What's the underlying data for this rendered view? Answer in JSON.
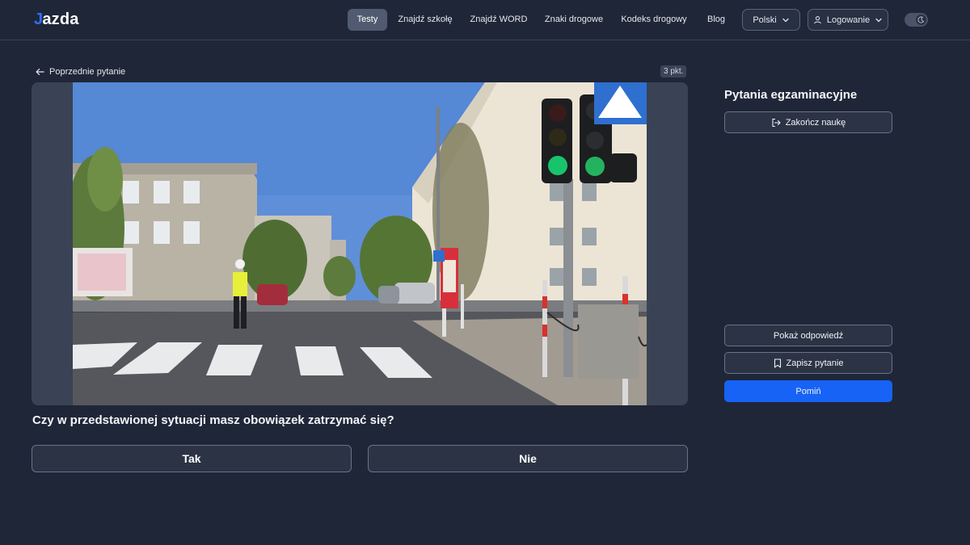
{
  "header": {
    "logo": {
      "mark": "J",
      "text": "azda"
    },
    "nav": [
      {
        "label": "Testy",
        "active": true
      },
      {
        "label": "Znajdź szkołę",
        "active": false
      },
      {
        "label": "Znajdź WORD",
        "active": false
      },
      {
        "label": "Znaki drogowe",
        "active": false
      },
      {
        "label": "Kodeks drogowy",
        "active": false
      },
      {
        "label": "Blog",
        "active": false
      }
    ],
    "language": "Polski",
    "login": "Logowanie",
    "theme_toggle_icon": "moon-icon"
  },
  "question": {
    "back_label": "Poprzednie pytanie",
    "points": "3 pkt.",
    "text": "Czy w przedstawionej sytuacji masz obowiązek zatrzymać się?",
    "answers": [
      "Tak",
      "Nie"
    ],
    "image_icon": "traffic-scene"
  },
  "side_panel": {
    "title": "Pytania egzaminacyjne",
    "end_label": "Zakończ naukę",
    "show_answer_label": "Pokaż odpowiedź",
    "save_label": "Zapisz pytanie",
    "skip_label": "Pomiń"
  },
  "colors": {
    "background": "#1f2637",
    "accent": "#1763f5",
    "logo_mark": "#2f6df6"
  }
}
